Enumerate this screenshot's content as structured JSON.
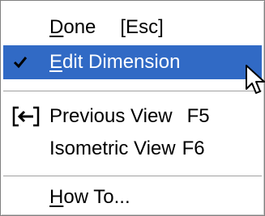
{
  "menu": {
    "items": [
      {
        "prefix": "",
        "mnemonic": "D",
        "rest": "one",
        "shortcut": "[Esc]",
        "checked": false,
        "highlighted": false
      },
      {
        "prefix": "",
        "mnemonic": "E",
        "rest": "dit Dimension",
        "shortcut": "",
        "checked": true,
        "highlighted": true
      },
      {
        "prefix": "Previous View",
        "mnemonic": "",
        "rest": "",
        "shortcut": "F5",
        "icon": "previous-view-icon"
      },
      {
        "prefix": "Isometric View",
        "mnemonic": "",
        "rest": "",
        "shortcut": "F6"
      },
      {
        "prefix": "",
        "mnemonic": "H",
        "rest": "ow To...",
        "shortcut": ""
      }
    ]
  },
  "colors": {
    "highlight": "#316ac5",
    "highlight_text": "#ffffff",
    "text": "#000000",
    "separator": "#a0a0a0"
  },
  "icons": [
    "checkmark-icon",
    "previous-view-icon",
    "mouse-pointer-icon"
  ]
}
